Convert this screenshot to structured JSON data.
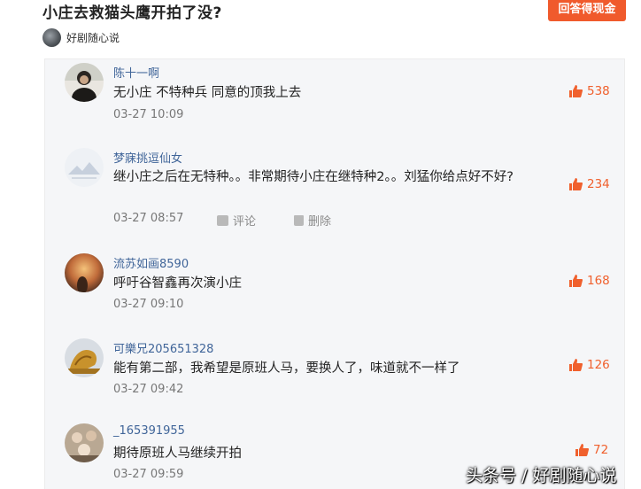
{
  "question": {
    "title": "小庄去救猫头鹰开拍了没?",
    "answer_button": "回答得现金",
    "author": "好剧随心说"
  },
  "comments": [
    {
      "user": "陈十一啊",
      "text": "无小庄 不特种兵 同意的顶我上去",
      "time": "03-27 10:09",
      "likes": "538",
      "avatar_icon": "person-portrait"
    },
    {
      "user": "梦寐挑逗仙女",
      "text": "继小庄之后在无特种。。非常期待小庄在继特种2。。刘猛你给点好不好?",
      "time": "03-27 08:57",
      "likes": "234",
      "reply_label": "评论",
      "delete_label": "删除",
      "avatar_icon": "mountain-sketch"
    },
    {
      "user": "流苏如画8590",
      "text": "呼吁谷智鑫再次演小庄",
      "time": "03-27 09:10",
      "likes": "168",
      "avatar_icon": "sunset-portrait"
    },
    {
      "user": "可樂兄205651328",
      "text": "能有第二部，我希望是原班人马，要换人了，味道就不一样了",
      "time": "03-27 09:42",
      "likes": "126",
      "avatar_icon": "dragon-sculpture"
    },
    {
      "user": "_165391955",
      "text": "期待原班人马继续开拍",
      "time": "03-27 09:59",
      "likes": "72",
      "avatar_icon": "group-photo"
    }
  ],
  "watermark": "头条号 / 好剧随心说",
  "colors": {
    "accent": "#f05a2c",
    "username": "#406599",
    "like": "#f0602d",
    "panel_bg": "#f5f6f8"
  }
}
